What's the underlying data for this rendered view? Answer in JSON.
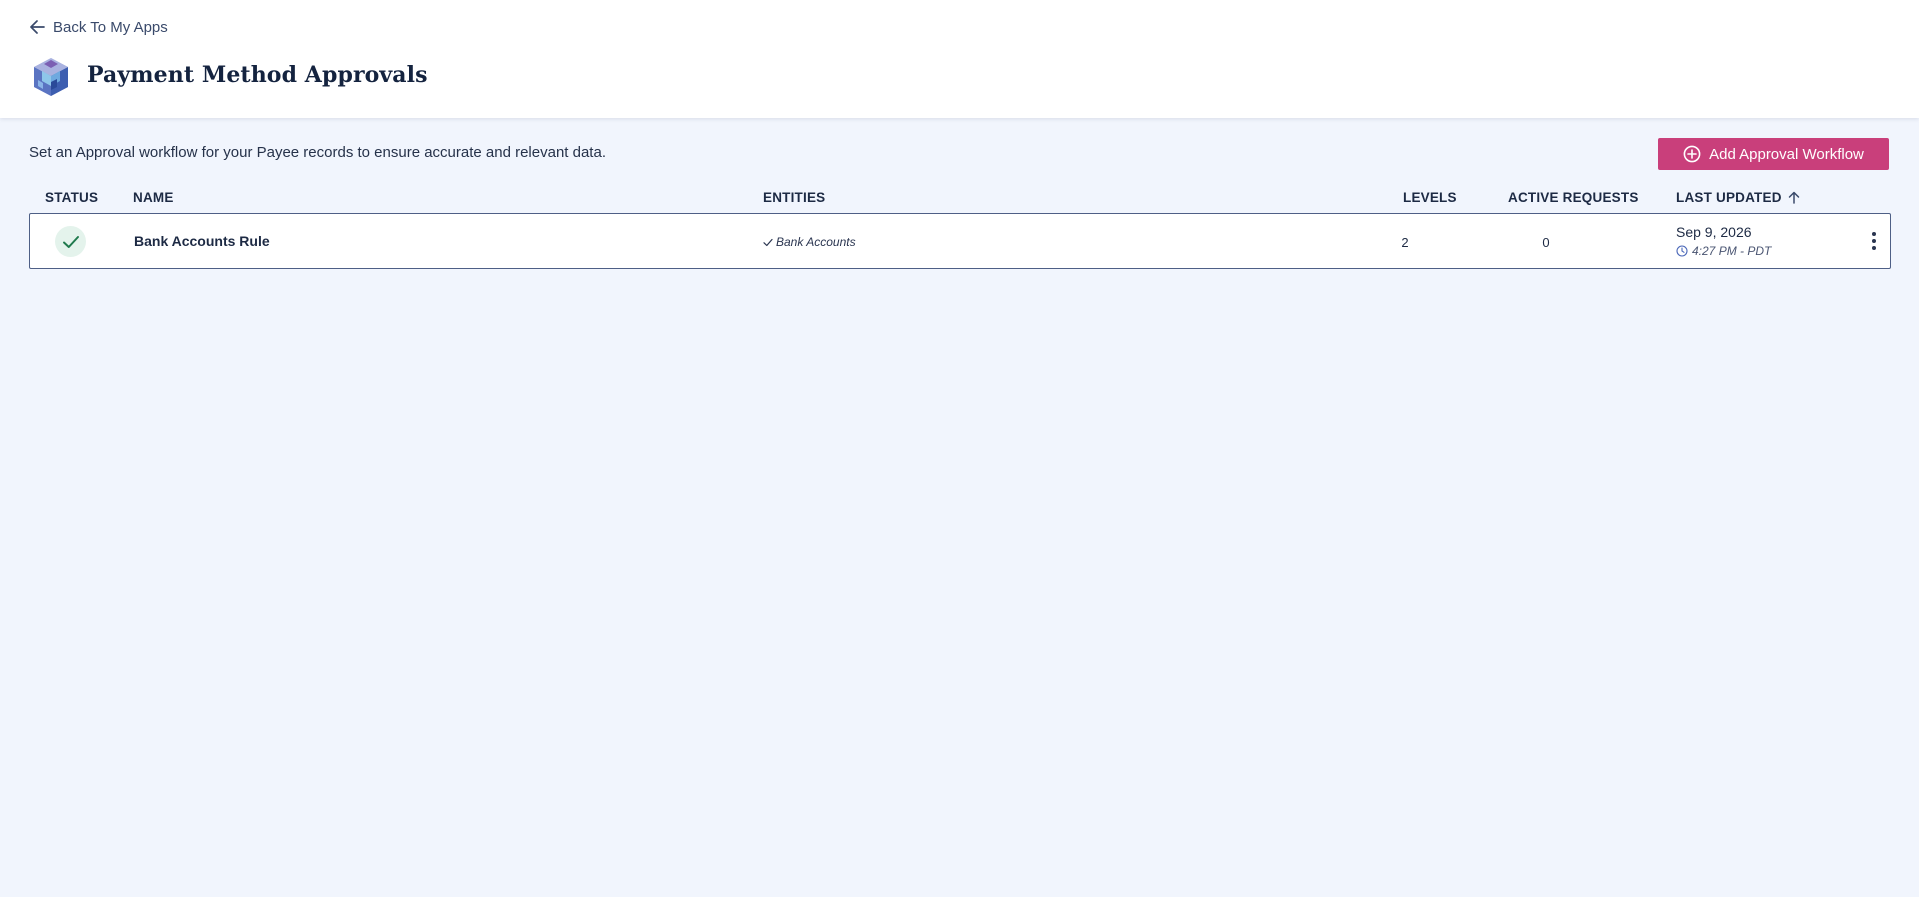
{
  "header": {
    "back_label": "Back To My Apps",
    "title": "Payment Method Approvals",
    "logo_icon": "cube-logo-icon"
  },
  "main": {
    "description": "Set an Approval workflow for your Payee records to ensure accurate and relevant data.",
    "add_button_label": "Add Approval Workflow",
    "add_button_icon": "plus-circle-icon",
    "accent_color": "#c93f7b"
  },
  "table": {
    "columns": {
      "status": "STATUS",
      "name": "NAME",
      "entities": "ENTITIES",
      "levels": "LEVELS",
      "active_requests": "ACTIVE REQUESTS",
      "last_updated": "LAST UPDATED"
    },
    "sort": {
      "column": "last_updated",
      "direction": "ascending"
    },
    "rows": [
      {
        "status": "active",
        "status_icon": "check-icon",
        "name": "Bank Accounts Rule",
        "entities": [
          "Bank Accounts"
        ],
        "levels": "2",
        "active_requests": "0",
        "date": "Sep 9, 2026",
        "time": "4:27 PM - PDT"
      }
    ]
  }
}
